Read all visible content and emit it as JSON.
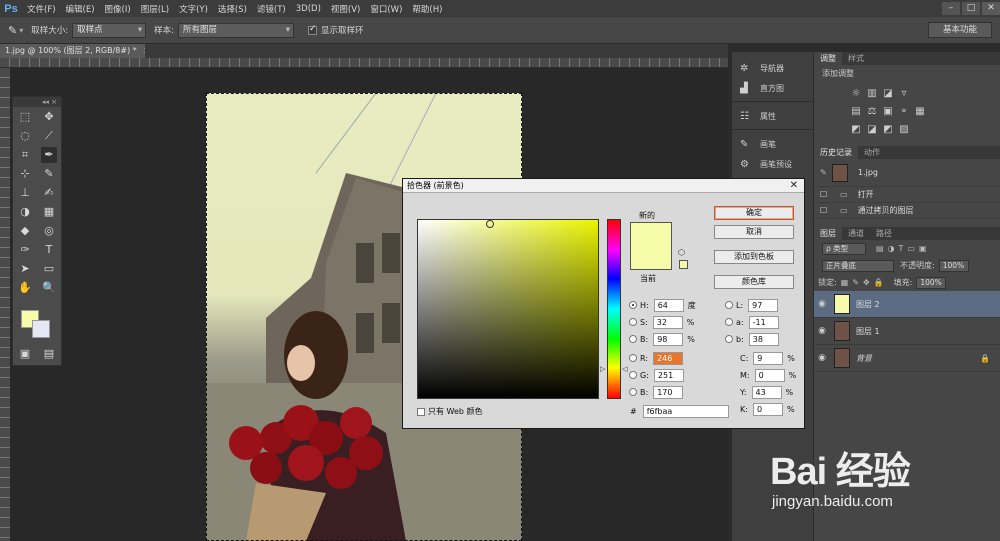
{
  "app": {
    "logo": "Ps"
  },
  "menu": [
    "文件(F)",
    "编辑(E)",
    "图像(I)",
    "图层(L)",
    "文字(Y)",
    "选择(S)",
    "滤镜(T)",
    "3D(D)",
    "视图(V)",
    "窗口(W)",
    "帮助(H)"
  ],
  "window_controls": {
    "minimize": "–",
    "maximize": "□",
    "close": "✕"
  },
  "options": {
    "sample_size_label": "取样大小:",
    "sample_size_value": "取样点",
    "sample_label": "样本:",
    "sample_value": "所有图层",
    "show_ring_label": "显示取样环",
    "workspace": "基本功能"
  },
  "document": {
    "tab": "1.jpg @ 100% (图层 2, RGB/8#) *",
    "tab_close": "×"
  },
  "toolbox": {
    "tools": [
      [
        "⬚",
        "✥"
      ],
      [
        "◌",
        "⟋"
      ],
      [
        "⌗",
        "✒"
      ],
      [
        "⊹",
        "✎"
      ],
      [
        "⊥",
        "✍"
      ],
      [
        "◑",
        "▦"
      ],
      [
        "◆",
        "◎"
      ],
      [
        "✑",
        "T"
      ],
      [
        "➤",
        "▭"
      ],
      [
        "✋",
        "🔍"
      ],
      [
        "▣",
        "▤"
      ]
    ],
    "fg_color": "#f6fbaa",
    "bg_color": "#e8e8f4"
  },
  "strip_panel": [
    {
      "icon": "navigator-icon",
      "glyph": "✲",
      "label": "导航器"
    },
    {
      "icon": "histogram-icon",
      "glyph": "▟",
      "label": "直方图"
    },
    {
      "icon": "properties-icon",
      "glyph": "☷",
      "label": "属性"
    },
    {
      "icon": "brush-icon",
      "glyph": "✎",
      "label": "画笔"
    },
    {
      "icon": "brush-presets-icon",
      "glyph": "⚙",
      "label": "画笔预设"
    }
  ],
  "adjustments": {
    "tabs": [
      "调整",
      "样式"
    ],
    "title": "添加调整",
    "rows": [
      [
        "☼",
        "▥",
        "◪",
        "▿"
      ],
      [
        "▤",
        "⚖",
        "▣",
        "⚬",
        "▦"
      ],
      [
        "◩",
        "◪",
        "◩",
        "▨"
      ]
    ]
  },
  "history": {
    "tabs": [
      "历史记录",
      "动作"
    ],
    "snapshot": "1.jpg",
    "items": [
      "打开",
      "通过拷贝的图层"
    ]
  },
  "layers": {
    "tabs": [
      "图层",
      "通道",
      "路径"
    ],
    "kind_label": "ρ 类型",
    "blend_mode": "正片叠底",
    "opacity_label": "不透明度:",
    "opacity_value": "100%",
    "lock_label": "锁定:",
    "fill_label": "填充:",
    "fill_value": "100%",
    "items": [
      {
        "name": "图层 2",
        "selected": true,
        "thumb": "#f6fbaa"
      },
      {
        "name": "图层 1",
        "selected": false,
        "thumb": "#6e5246"
      },
      {
        "name": "背景",
        "selected": false,
        "thumb": "#6e5246",
        "locked": true
      }
    ]
  },
  "picker": {
    "title": "拾色器 (前景色)",
    "new_label": "新的",
    "current_label": "当前",
    "buttons": {
      "ok": "确定",
      "cancel": "取消",
      "add_swatch": "添加到色板",
      "libraries": "颜色库"
    },
    "hsb": [
      {
        "key": "H:",
        "value": "64",
        "unit": "度",
        "checked": true
      },
      {
        "key": "S:",
        "value": "32",
        "unit": "%"
      },
      {
        "key": "B:",
        "value": "98",
        "unit": "%"
      }
    ],
    "rgb": [
      {
        "key": "R:",
        "value": "246"
      },
      {
        "key": "G:",
        "value": "251"
      },
      {
        "key": "B:",
        "value": "170"
      }
    ],
    "lab": [
      {
        "key": "L:",
        "value": "97"
      },
      {
        "key": "a:",
        "value": "-11"
      },
      {
        "key": "b:",
        "value": "38"
      }
    ],
    "cmyk": [
      {
        "key": "C:",
        "value": "9",
        "unit": "%"
      },
      {
        "key": "M:",
        "value": "0",
        "unit": "%"
      },
      {
        "key": "Y:",
        "value": "43",
        "unit": "%"
      },
      {
        "key": "K:",
        "value": "0",
        "unit": "%"
      }
    ],
    "web_only_label": "只有 Web 颜色",
    "hex_label": "#",
    "hex_value": "f6fbaa",
    "color": "#f6fbaa"
  },
  "watermark": {
    "logo": "Bai 经验",
    "url": "jingyan.baidu.com"
  }
}
